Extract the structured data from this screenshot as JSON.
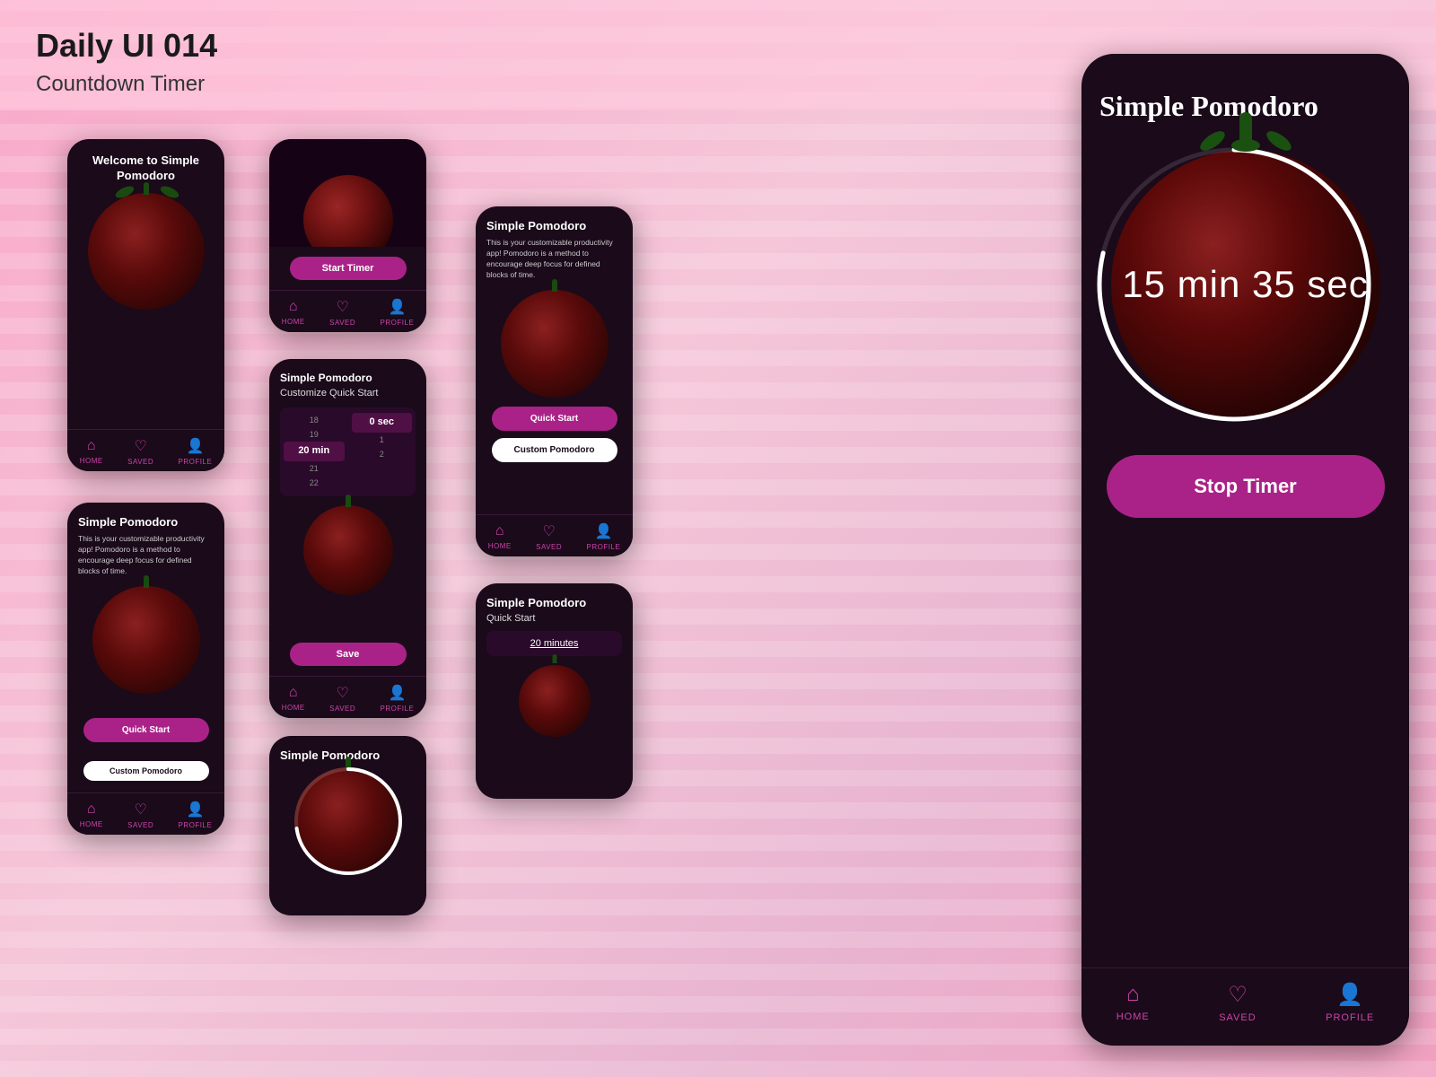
{
  "header": {
    "title": "Daily UI 014",
    "subtitle": "Countdown Timer"
  },
  "phones": {
    "phone1": {
      "welcome_text": "Welcome to Simple\nPomodoro"
    },
    "phone2": {
      "start_btn": "Start Timer"
    },
    "phone3": {
      "app_title": "Simple Pomodoro",
      "section_title": "Customize Quick Start",
      "picker_min_values": [
        "18",
        "19",
        "20 min",
        "21",
        "22"
      ],
      "picker_sec_values": [
        "",
        "",
        "0 sec",
        "1",
        "2"
      ],
      "save_btn": "Save"
    },
    "phone4": {
      "app_title": "Simple Pomodoro",
      "description": "This is your customizable productivity app! Pomodoro is a method to encourage deep focus for defined blocks of time.",
      "quick_start_btn": "Quick Start",
      "custom_btn": "Custom Pomodoro"
    },
    "phone5": {
      "app_title": "Simple Pomodoro",
      "description": "This is your customizable productivity app! Pomodoro is a method to encourage deep focus for defined blocks of time.",
      "quick_start_btn": "Quick Start",
      "custom_btn": "Custom Pomodoro"
    },
    "phone6": {
      "app_title": "Simple Pomodoro",
      "section_title": "Quick Start",
      "minutes_text": "20 minutes"
    },
    "phone7": {
      "app_title": "Simple Pomodoro"
    },
    "phoneMain": {
      "app_title": "Simple Pomodoro",
      "timer_display": "15 min 35 sec",
      "stop_btn": "Stop Timer"
    }
  },
  "nav": {
    "home": "HOME",
    "saved": "SAVED",
    "profile": "PROFILE"
  }
}
